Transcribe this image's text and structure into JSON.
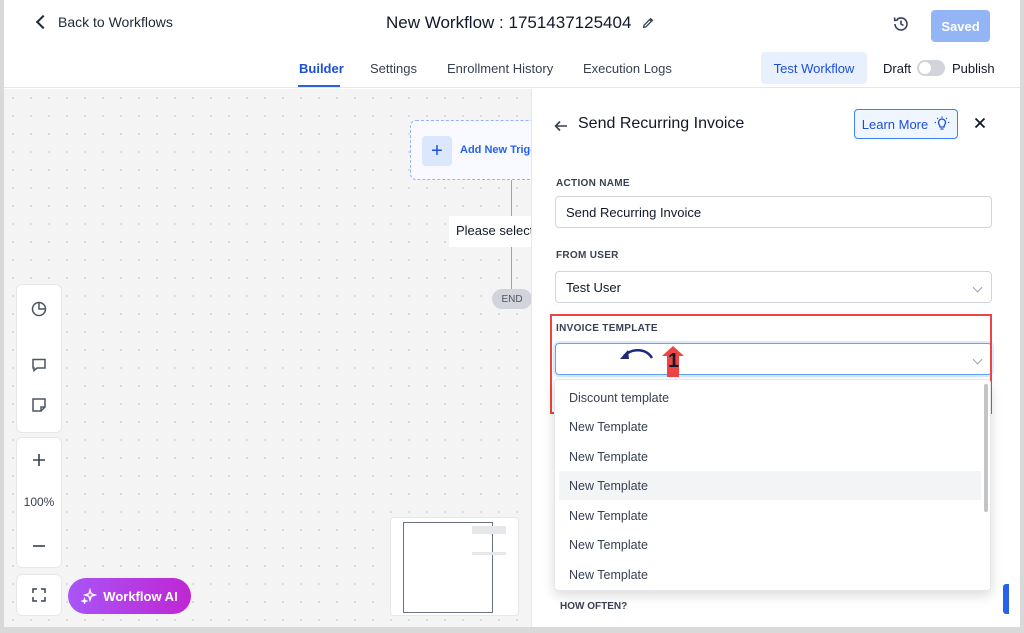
{
  "header": {
    "back_label": "Back to Workflows",
    "title": "New Workflow : 1751437125404",
    "saved_label": "Saved"
  },
  "tabs": [
    {
      "label": "Builder",
      "active": true
    },
    {
      "label": "Settings",
      "active": false
    },
    {
      "label": "Enrollment History",
      "active": false
    },
    {
      "label": "Execution Logs",
      "active": false
    }
  ],
  "actions": {
    "test_label": "Test Workflow",
    "draft_label": "Draft",
    "publish_label": "Publish",
    "published": false
  },
  "canvas": {
    "trigger_label": "Add New Trigger",
    "please_select": "Please select",
    "end_label": "END",
    "zoom": "100%",
    "ai_label": "Workflow AI"
  },
  "panel": {
    "title": "Send Recurring Invoice",
    "learn_more": "Learn More",
    "action_name_label": "ACTION NAME",
    "action_name_value": "Send Recurring Invoice",
    "from_user_label": "FROM USER",
    "from_user_value": "Test User",
    "invoice_template_label": "INVOICE TEMPLATE",
    "invoice_template_value": "",
    "how_often_label": "HOW OFTEN?"
  },
  "dropdown": {
    "options": [
      "Discount template",
      "New Template",
      "New Template",
      "New Template",
      "New Template",
      "New Template",
      "New Template"
    ],
    "highlighted_index": 3
  },
  "annotation": {
    "step_number": "1",
    "color": "#ef4444"
  },
  "colors": {
    "accent": "#2563eb",
    "saved_button": "#93b4f5",
    "ai_gradient_start": "#a855f7",
    "ai_gradient_end": "#c026d3"
  }
}
